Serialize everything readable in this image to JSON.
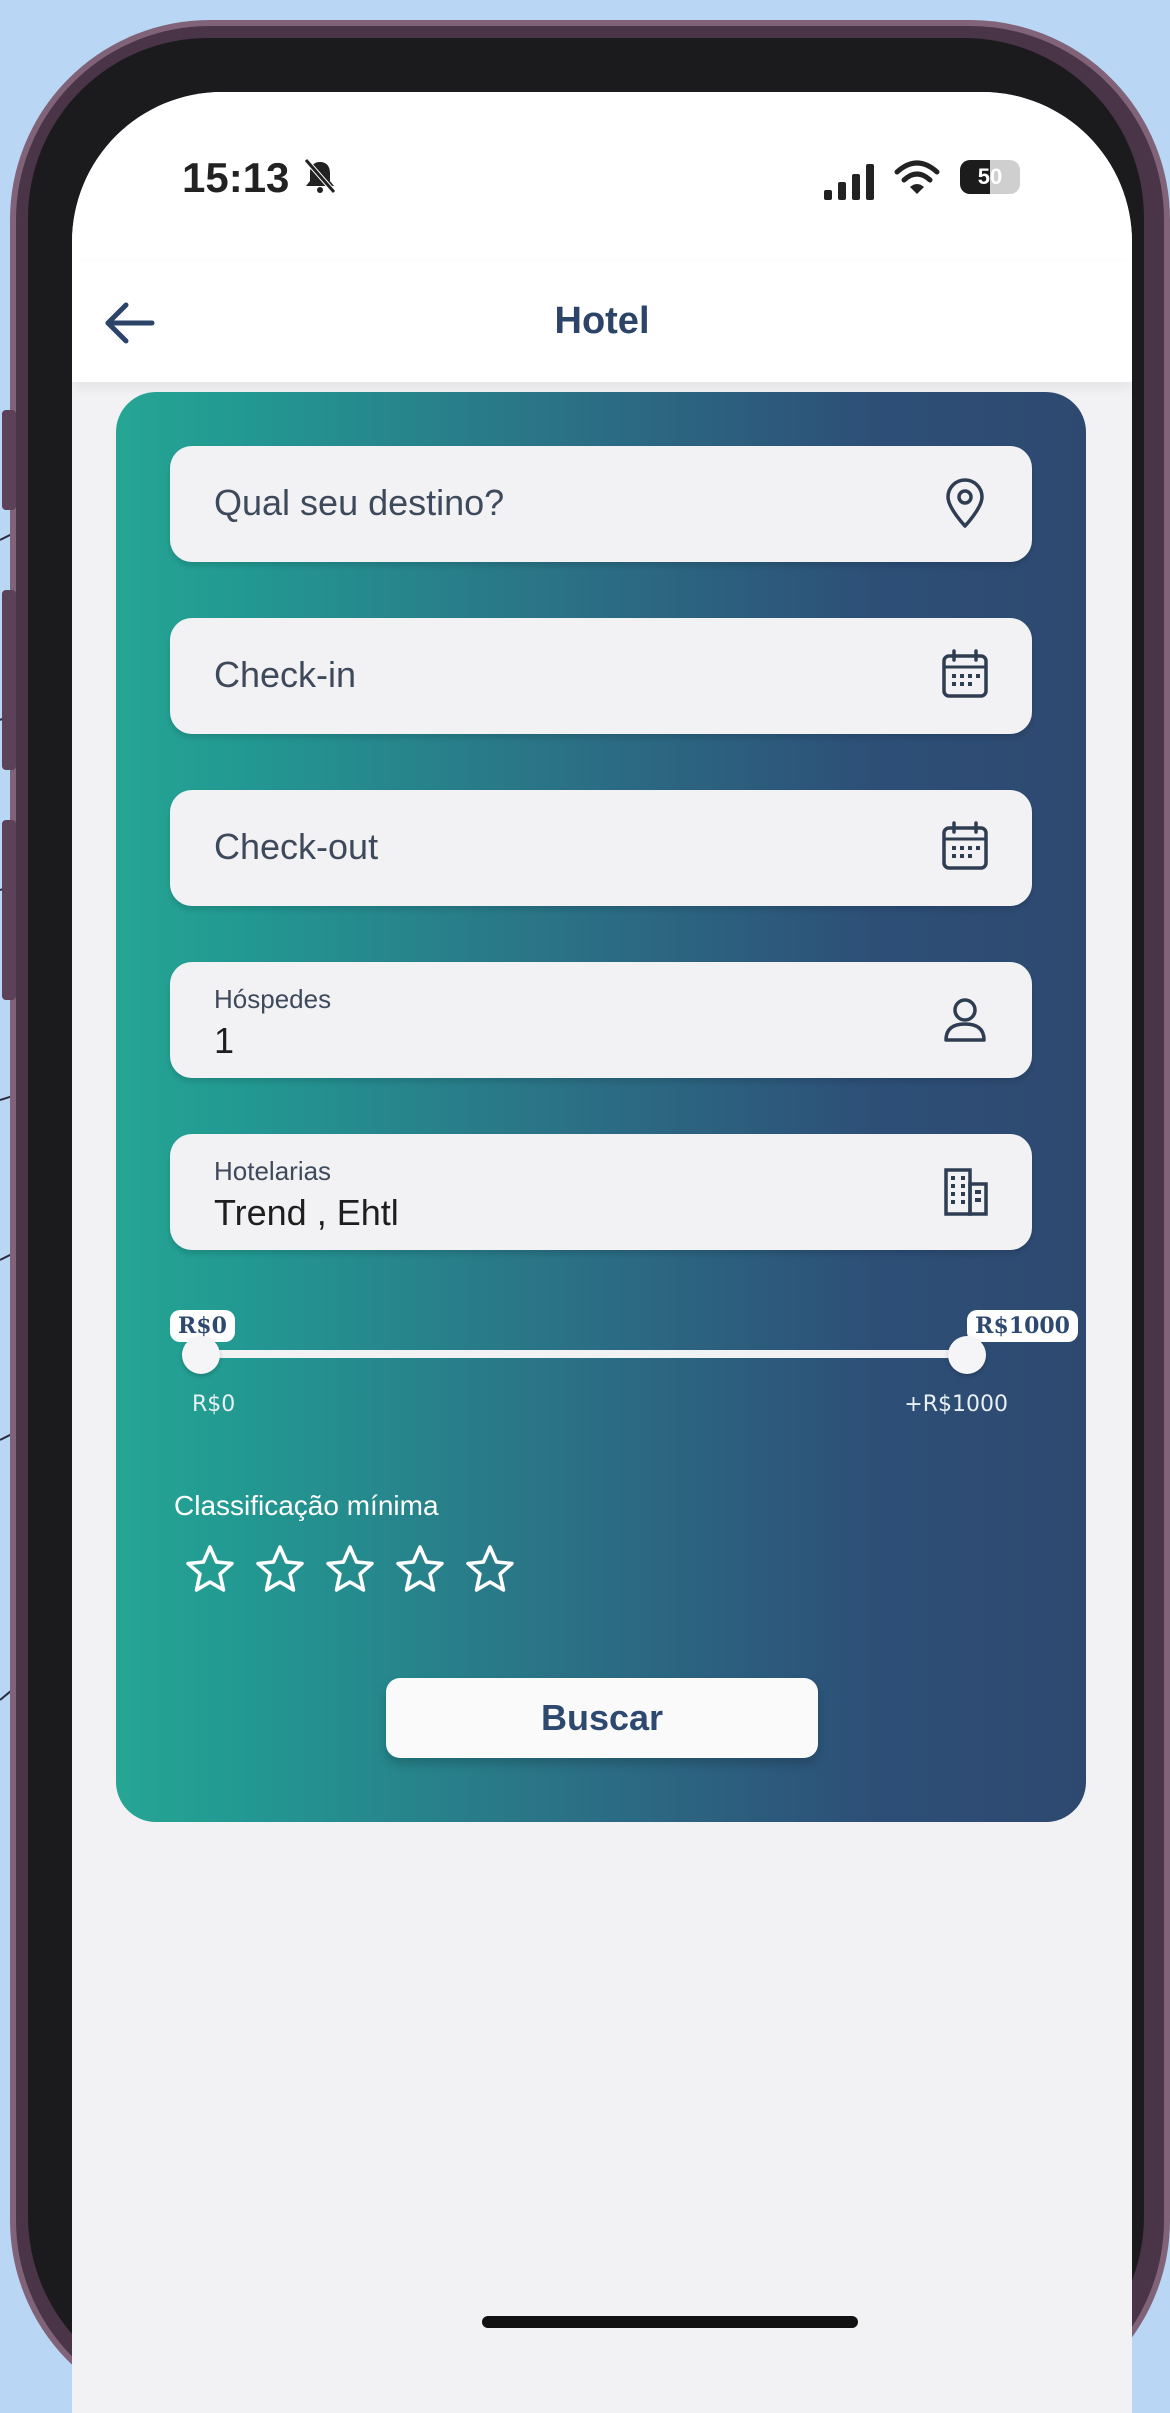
{
  "status_bar": {
    "time": "15:13",
    "battery": "50",
    "battery_level": 0.5
  },
  "app_bar": {
    "title": "Hotel"
  },
  "form": {
    "destination_placeholder": "Qual seu destino?",
    "checkin_placeholder": "Check-in",
    "checkout_placeholder": "Check-out",
    "guests": {
      "label": "Hóspedes",
      "value": "1"
    },
    "hotel_chains": {
      "label": "Hotelarias",
      "value": "Trend , Ehtl"
    }
  },
  "price_range": {
    "min_badge": "R$0",
    "max_badge": "R$1000",
    "min_label": "R$0",
    "max_label": "+R$1000",
    "selected_min": 0,
    "selected_max": 1000
  },
  "rating": {
    "label": "Classificação mínima",
    "selected": 0,
    "max": 5
  },
  "actions": {
    "search_label": "Buscar"
  },
  "colors": {
    "gradient_start": "#26a594",
    "gradient_end": "#2e4970",
    "title_color": "#2c4468",
    "background": "#b9d6f5",
    "frame": "#4a3447"
  },
  "icons": {
    "destination": "location-pin-icon",
    "checkin": "calendar-icon",
    "checkout": "calendar-icon",
    "guests": "person-icon",
    "hotel_chains": "building-icon",
    "rating": "star-outline-icon"
  }
}
